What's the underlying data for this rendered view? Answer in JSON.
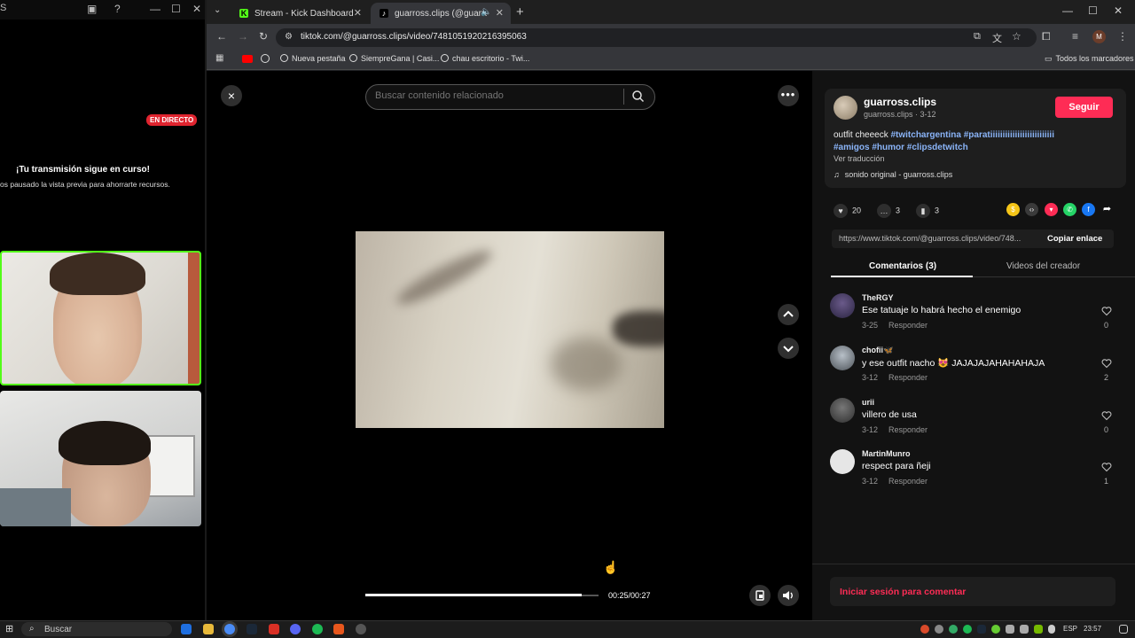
{
  "left_window": {
    "title_partial": "S",
    "live_badge": "EN DIRECTO",
    "message_title": "¡Tu transmisión sigue en curso!",
    "message_sub": "os pausado la vista previa para ahorrarte recursos."
  },
  "browser": {
    "tabs": [
      {
        "label": "Stream - Kick Dashboard",
        "active": false
      },
      {
        "label": "guarross.clips (@guarross.c",
        "active": true
      }
    ],
    "url": "tiktok.com/@guarross.clips/video/7481051920216395063",
    "bookmarks": [
      {
        "label": "Nueva pestaña"
      },
      {
        "label": "SiempreGana | Casi..."
      },
      {
        "label": "chau escritorio - Twi..."
      }
    ],
    "all_bookmarks": "Todos los marcadores",
    "profile_initial": "M"
  },
  "player": {
    "close_icon": "×",
    "search_placeholder": "Buscar contenido relacionado",
    "more_icon": "•••",
    "time": "00:25/00:27",
    "progress_fraction": 0.926
  },
  "post": {
    "author_name": "guarross.clips",
    "author_meta": "guarross.clips · 3-12",
    "follow_label": "Seguir",
    "caption": "outfit cheeeck ",
    "hashtags_line1": "#twitchargentina #paratiiiiiiiiiiiiiiiiiiiiiiiiii",
    "hashtags_line2": "#amigos #humor #clipsdetwitch",
    "translate_label": "Ver traducción",
    "sound": "sonido original - guarross.clips",
    "likes": "20",
    "comments_count": "3",
    "saves": "3",
    "link": "https://www.tiktok.com/@guarross.clips/video/748...",
    "copy_label": "Copiar enlace",
    "tab_comments": "Comentarios (3)",
    "tab_creator": "Videos del creador",
    "login_prompt": "Iniciar sesión para comentar"
  },
  "comments": [
    {
      "user": "TheRGY",
      "text": "Ese tatuaje lo habrá hecho el enemigo",
      "date": "3-25",
      "reply": "Responder",
      "likes": "0"
    },
    {
      "user": "chofii🦋",
      "text": "y ese outfit nacho 😻 JAJAJAJAHAHAHAJA",
      "date": "3-12",
      "reply": "Responder",
      "likes": "2"
    },
    {
      "user": "urii",
      "text": "villero de usa",
      "date": "3-12",
      "reply": "Responder",
      "likes": "0"
    },
    {
      "user": "MartinMunro",
      "text": "respect para ñeji",
      "date": "3-12",
      "reply": "Responder",
      "likes": "1"
    }
  ],
  "taskbar": {
    "search_placeholder": "Buscar",
    "lang": "ESP",
    "time": "23:57"
  },
  "colors": {
    "accent": "#fe2c55",
    "kick": "#53fc18",
    "link": "#8ab4f8"
  }
}
